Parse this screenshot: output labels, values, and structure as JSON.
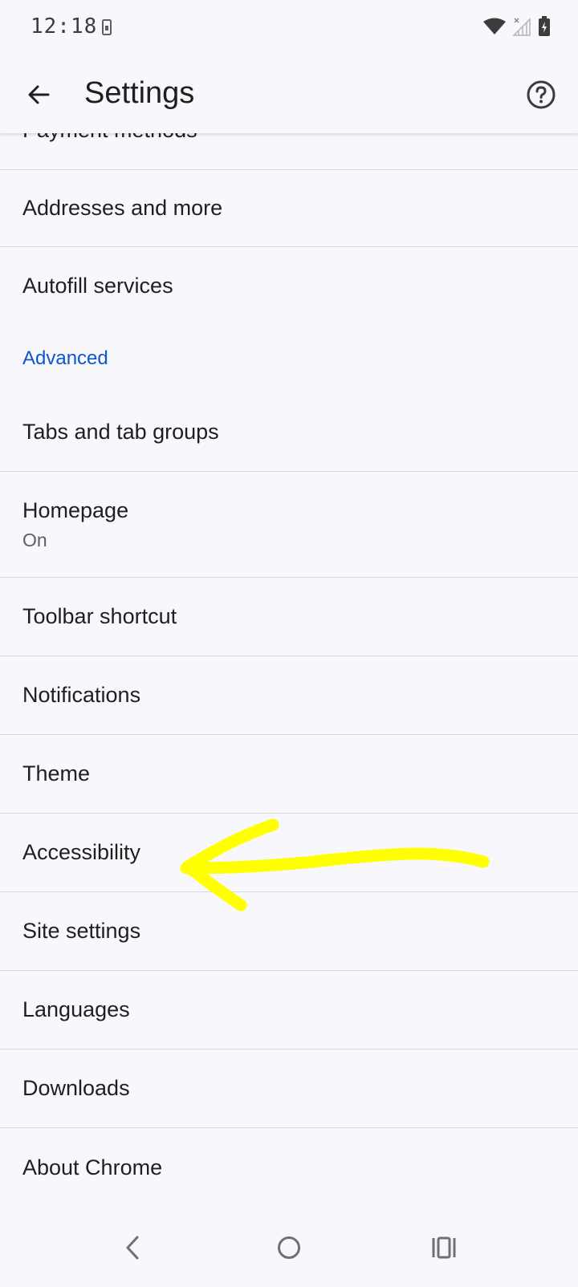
{
  "status_bar": {
    "time": "12:18",
    "icons": [
      "sim-card-icon",
      "wifi-icon",
      "signal-icon",
      "battery-charging-icon"
    ]
  },
  "app_bar": {
    "title": "Settings",
    "back_icon": "arrow-back-icon",
    "help_icon": "help-icon"
  },
  "settings": {
    "payment_methods": "Payment methods",
    "addresses": "Addresses and more",
    "autofill_services": "Autofill services",
    "advanced_header": "Advanced",
    "tabs": "Tabs and tab groups",
    "homepage": "Homepage",
    "homepage_status": "On",
    "toolbar_shortcut": "Toolbar shortcut",
    "notifications": "Notifications",
    "theme": "Theme",
    "accessibility": "Accessibility",
    "site_settings": "Site settings",
    "languages": "Languages",
    "downloads": "Downloads",
    "about_chrome": "About Chrome"
  },
  "annotation": {
    "color": "#ffff00",
    "icon": "arrow-annotation-icon"
  },
  "colors": {
    "accent": "#0b57d0",
    "background": "#f8f8fc",
    "divider": "#d9d9de"
  },
  "nav_bar": {
    "icons": [
      "nav-back-icon",
      "nav-home-icon",
      "nav-recents-icon"
    ]
  }
}
